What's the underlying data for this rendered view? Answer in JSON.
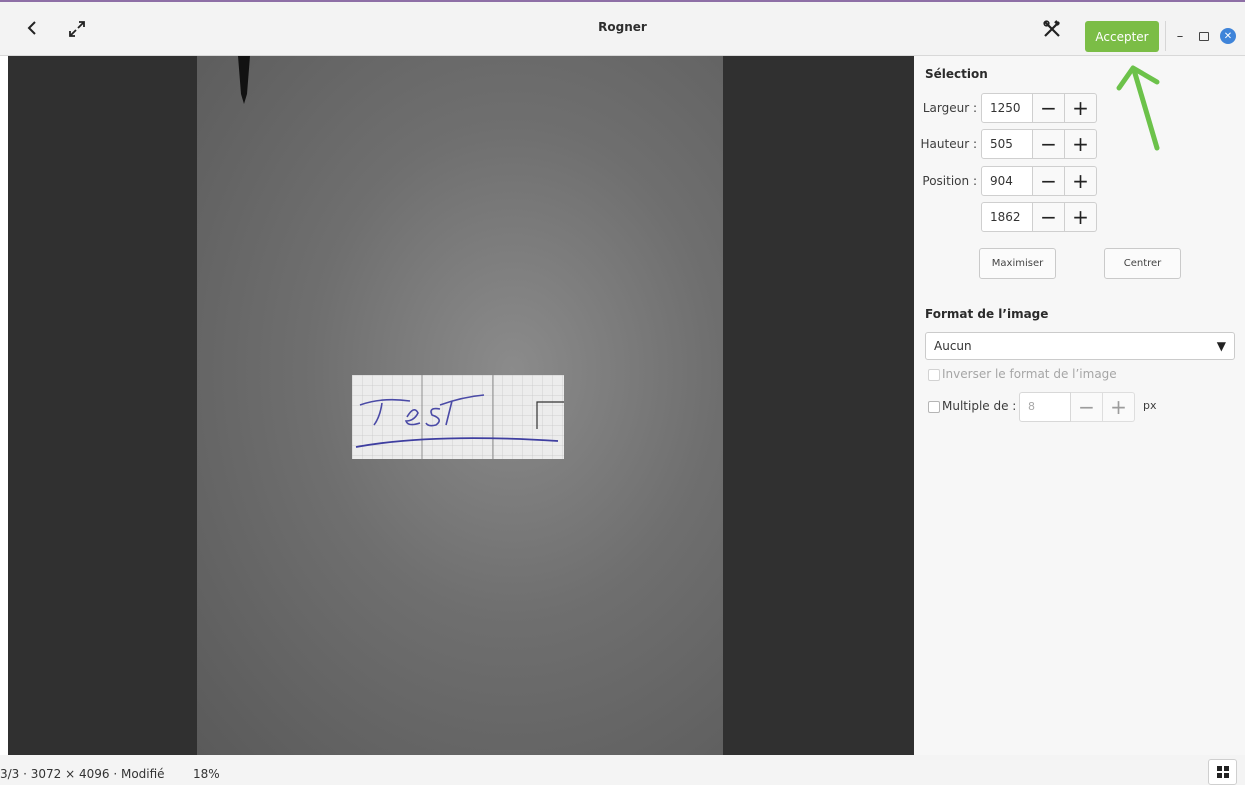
{
  "window": {
    "title": "Rogner",
    "accept_label": "Accepter",
    "icons": [
      "back-icon",
      "fullscreen-icon",
      "tools-icon",
      "minimize-icon",
      "maximize-icon",
      "close-icon"
    ]
  },
  "panel": {
    "selection_title": "Sélection",
    "width_label": "Largeur :",
    "width_value": "1250",
    "height_label": "Hauteur :",
    "height_value": "505",
    "position_label": "Position :",
    "position_x": "904",
    "position_y": "1862",
    "maximize_label": "Maximiser",
    "center_label": "Centrer",
    "format_title": "Format de l’image",
    "format_value": "Aucun",
    "invert_label": "Inverser le format de l’image",
    "multiple_label": "Multiple de :",
    "multiple_value": "8",
    "multiple_unit": "px"
  },
  "image": {
    "handwritten_text": "Test"
  },
  "status": {
    "info": "3/3 · 3072 × 4096 · Modifié",
    "zoom": "18%"
  },
  "colors": {
    "accent": "#7bbd46",
    "close_button": "#3f84d9",
    "annotation_arrow": "#6cc24a",
    "viewer_background": "#303030"
  }
}
